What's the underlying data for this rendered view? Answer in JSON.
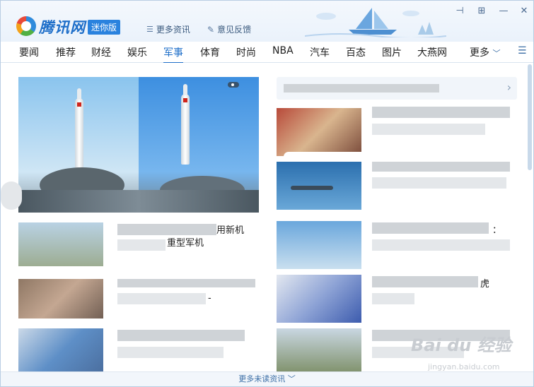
{
  "header": {
    "logo_text": "腾讯网",
    "badge": "迷你版",
    "more_news_label": "更多资讯",
    "feedback_label": "意见反馈"
  },
  "controls": {
    "pin": "⊣",
    "restore": "⊞",
    "minimize": "—",
    "close": "✕"
  },
  "nav": {
    "tabs": [
      {
        "label": "要闻"
      },
      {
        "label": "推荐"
      },
      {
        "label": "财经"
      },
      {
        "label": "娱乐"
      },
      {
        "label": "军事"
      },
      {
        "label": "体育"
      },
      {
        "label": "时尚"
      },
      {
        "label": "NBA"
      },
      {
        "label": "汽车"
      },
      {
        "label": "百态"
      },
      {
        "label": "图片"
      },
      {
        "label": "大燕网"
      }
    ],
    "active": "军事",
    "more_label": "更多",
    "menu_icon": "☰"
  },
  "content": {
    "visible_caption_1": "用新机",
    "visible_caption_2": "重型军机",
    "visible_caption_3": "-",
    "visible_caption_4": "：",
    "visible_caption_5": "虎"
  },
  "footer": {
    "more_unread_label": "更多未读资讯"
  },
  "watermark": {
    "text": "Bai du 经验",
    "sub": "jingyan.baidu.com"
  },
  "colors": {
    "accent": "#1f6fc9",
    "header_bg": "#eaf2fb"
  }
}
